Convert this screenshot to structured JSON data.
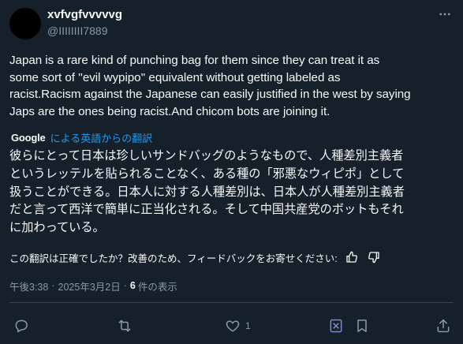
{
  "author": {
    "display_name": "xvfvgfvvvvvg",
    "handle": "@IIIIIIII7889"
  },
  "post": {
    "text": "Japan is a rare kind of punching bag for them since they can treat it as\nsome sort of ''evil wypipo'' equivalent without getting labeled as\nracist.Racism against the Japanese can easily justified in the west by saying\nJaps are the ones being racist.And chicom bots are joining it."
  },
  "translation": {
    "provider": "Google",
    "link_label": "による英語からの翻訳",
    "text": "彼らにとって日本は珍しいサンドバッグのようなもので、人種差別主義者\nというレッテルを貼られることなく、ある種の「邪悪なウィピポ」として\n扱うことができる。日本人に対する人種差別は、日本人が人種差別主義者\nだと言って西洋で簡単に正当化される。そして中国共産党のボットもそれ\nに加わっている。",
    "feedback_prompt": "この翻訳は正確でしたか？改善のため、フィードバックをお寄せください:"
  },
  "meta": {
    "time": "午後3:38",
    "separator": "·",
    "date": "2025年3月2日",
    "view_count": "6",
    "view_label": "件の表示"
  },
  "actions": {
    "reply_count": "",
    "repost_count": "",
    "like_count": "1"
  },
  "icons": {
    "more": "more-horizontal-icon",
    "thumbs_up": "thumbs-up-icon",
    "thumbs_down": "thumbs-down-icon",
    "reply": "reply-icon",
    "repost": "repost-icon",
    "like": "heart-icon",
    "grok": "grok-icon",
    "bookmark": "bookmark-icon",
    "share": "share-icon"
  },
  "colors": {
    "background": "#15202b",
    "text": "#f7f9f9",
    "secondary": "#8b98a5",
    "accent": "#1d9bf0",
    "divider": "#38444d",
    "avatar": "#000000"
  }
}
